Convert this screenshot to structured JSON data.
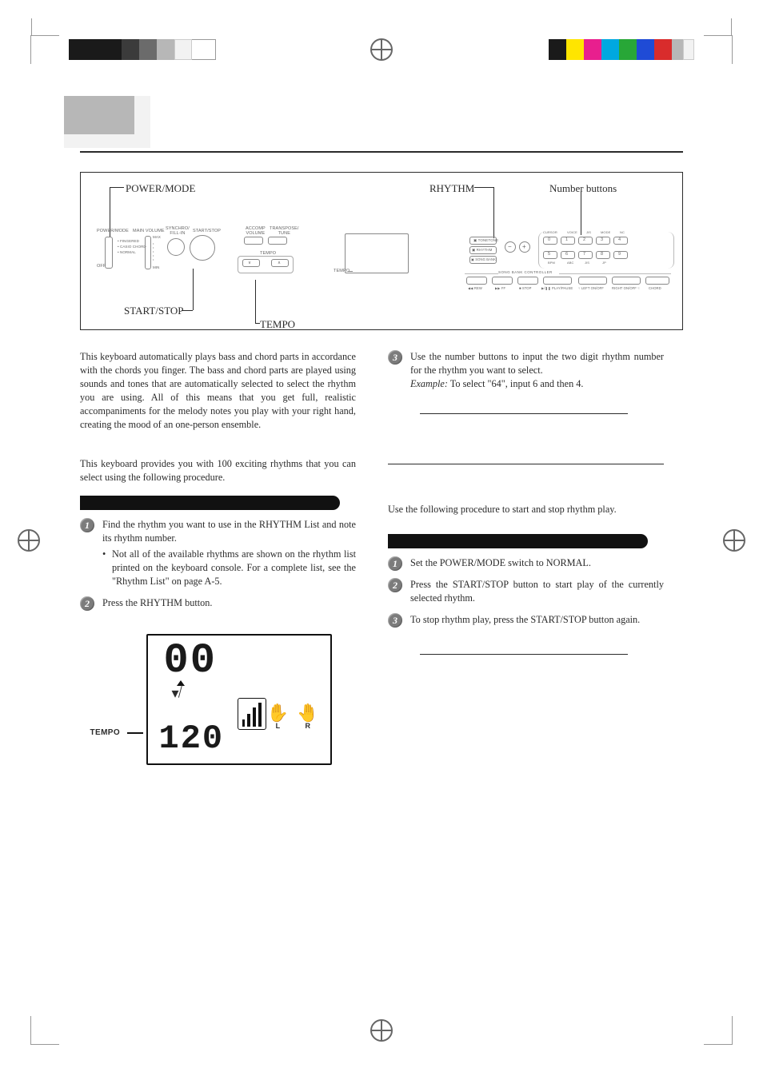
{
  "printer": {
    "left_swatches": [
      "sw-black",
      "sw-black",
      "sw-black",
      "sw-dkgrey",
      "sw-grey",
      "sw-ltgrey",
      "sw-white"
    ],
    "right_swatches": [
      "sw-black",
      "sw-yel",
      "sw-mag",
      "sw-cyan",
      "sw-green",
      "sw-blue",
      "sw-red",
      "sw-ltgrey",
      "sw-white"
    ]
  },
  "panel": {
    "labels": {
      "power_mode": "POWER/MODE",
      "rhythm": "RHYTHM",
      "number_buttons": "Number buttons",
      "start_stop": "START/STOP",
      "tempo": "TEMPO"
    },
    "tiny": {
      "power_mode": "POWER/MODE",
      "main_volume": "MAIN VOLUME",
      "synchro_fillin": "SYNCHRO/\nFILL-IN",
      "start_stop": "START/STOP",
      "accomp_volume": "ACCOMP\nVOLUME",
      "transpose_tune": "TRANSPOSE/\nTUNE",
      "tempo": "TEMPO",
      "down": "∨",
      "up": "∧",
      "modes": [
        "FINGERED",
        "CASIO CHORD",
        "NORMAL"
      ],
      "off": "OFF",
      "max": "MAX",
      "min": "MIN",
      "tone": "TONE",
      "rhythm": "RHYTHM",
      "songbank": "SONG BANK",
      "minus": "−",
      "plus": "+",
      "songbank_ctrl": "SONG BANK CONTROLLER",
      "rew": "◀◀ REW",
      "ff": "▶▶ FF",
      "stop": "■ STOP",
      "play": "▶/❚❚ PLAY/PAUSE",
      "left": "☟ LEFT ON/OFF",
      "right": "RIGHT ON/OFF ☟",
      "chord": "CHORD",
      "cursor": "CURSOR",
      "voice": "VOICE",
      "jpn": "JIS",
      "mode": "MODE",
      "nc": "NC",
      "num": [
        "0",
        "1",
        "2",
        "3",
        "4",
        "5",
        "6",
        "7",
        "8",
        "9"
      ],
      "sub": [
        "BPM",
        "ABC",
        "JIS",
        "JP"
      ]
    }
  },
  "left": {
    "intro": "This keyboard automatically plays bass and chord parts in accordance with the chords you finger. The bass and chord parts are played using sounds and tones that are automatically selected to select the rhythm you are using. All of this means that you get full, realistic accompaniments for the melody notes you play with your right hand, creating the mood of an one-person ensemble.",
    "select_rhythm_intro": "This keyboard provides you with 100 exciting rhythms that you can select using the following procedure.",
    "steps": {
      "s1": "Find the rhythm you want to use in the RHYTHM List and note its rhythm number.",
      "s1_bullet": "Not all of the available rhythms are shown on the rhythm list printed on the keyboard console. For a complete list, see the \"Rhythm List\" on page A-5.",
      "s2": "Press the RHYTHM button."
    },
    "lcd": {
      "num": "00",
      "tempo": "120",
      "tempo_label": "TEMPO",
      "hand_l": "L",
      "hand_r": "R"
    }
  },
  "right": {
    "step3": "Use the number buttons to input the two digit rhythm number for the rhythm you want to select.",
    "example_label": "Example:",
    "example_text": " To select \"64\", input 6 and then 4.",
    "play_intro": "Use the following procedure to start and stop rhythm play.",
    "steps": {
      "s1": "Set the POWER/MODE switch to NORMAL.",
      "s2": "Press the START/STOP button to start play of the currently selected rhythm.",
      "s3": "To stop rhythm play, press the START/STOP button again."
    }
  }
}
